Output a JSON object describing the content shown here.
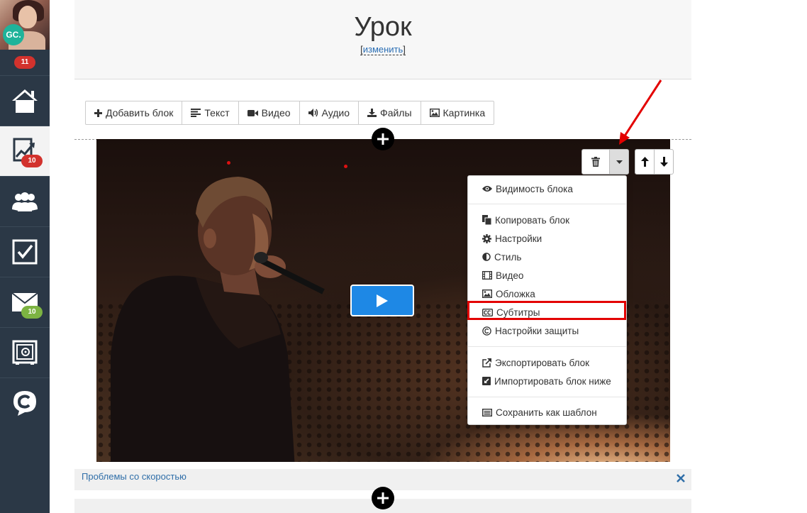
{
  "sidebar": {
    "avatar_initials": "GC.",
    "notifications_count": "11",
    "items": [
      {
        "icon": "home-icon",
        "badge": ""
      },
      {
        "icon": "chart-trend-icon",
        "badge": "10",
        "badge_color": "#d2322d"
      },
      {
        "icon": "users-icon",
        "badge": ""
      },
      {
        "icon": "checkbox-tasks-icon",
        "badge": ""
      },
      {
        "icon": "mail-icon",
        "badge": "10",
        "badge_color": "#7cb342"
      },
      {
        "icon": "safe-icon",
        "badge": ""
      },
      {
        "icon": "chat-c-icon",
        "badge": ""
      }
    ]
  },
  "header": {
    "title": "Урок",
    "edit_link": "изменить",
    "bracket_open": "[",
    "bracket_close": "]"
  },
  "toolbar": {
    "add_block": "Добавить блок",
    "text": "Текст",
    "video": "Видео",
    "audio": "Аудио",
    "files": "Файлы",
    "image": "Картинка"
  },
  "dropdown": {
    "visibility": "Видимость блока",
    "copy": "Копировать блок",
    "settings": "Настройки",
    "style": "Стиль",
    "video": "Видео",
    "cover": "Обложка",
    "subtitles": "Субтитры",
    "protection": "Настройки защиты",
    "export": "Экспортировать блок",
    "import": "Импортировать блок ниже",
    "save_template": "Сохранить как шаблон",
    "highlighted_item": "subtitles"
  },
  "notice": {
    "text": "Проблемы со скоростью"
  },
  "colors": {
    "sidebar_bg": "#2b3846",
    "accent_blue": "#1e88e5",
    "highlight_red": "#e30000",
    "badge_red": "#d2322d",
    "badge_green": "#7cb342",
    "link_blue": "#2f6ea8"
  }
}
